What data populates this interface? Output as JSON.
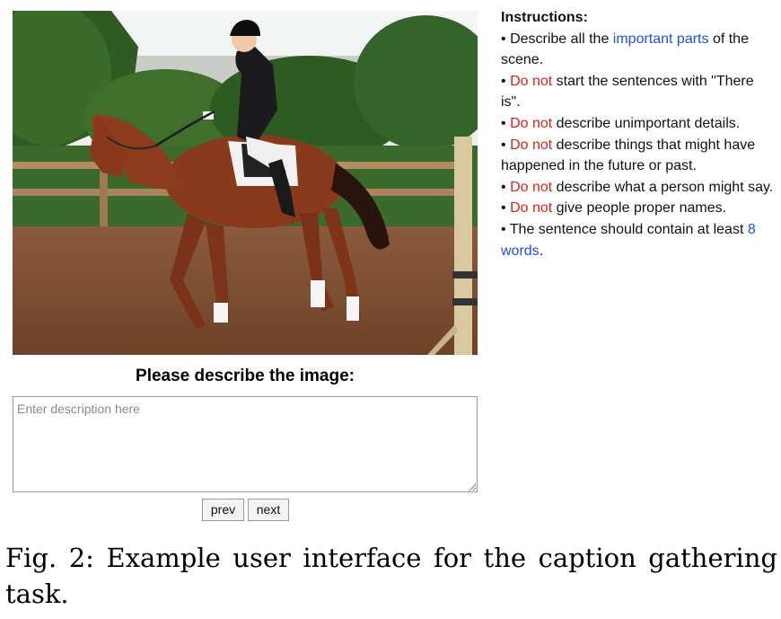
{
  "photo_icon": "horse-rider-photo",
  "instructions": {
    "title": "Instructions:",
    "items": [
      {
        "pre": "Describe all the ",
        "hl": "important parts",
        "post": " of the scene."
      },
      {
        "pre": "",
        "hl": "Do not",
        "post": " start the sentences with \"There is\"."
      },
      {
        "pre": "",
        "hl": "Do not",
        "post": " describe unimportant details."
      },
      {
        "pre": "",
        "hl": "Do not",
        "post": " describe things that might have happened in the future or past."
      },
      {
        "pre": "",
        "hl": "Do not",
        "post": " describe what a person might say."
      },
      {
        "pre": "",
        "hl": "Do not",
        "post": " give people proper names."
      },
      {
        "pre": "The sentence should contain at least ",
        "hl": "8 words",
        "post": "."
      }
    ],
    "bullet": "•"
  },
  "form": {
    "prompt": "Please describe the image:",
    "placeholder": "Enter description here",
    "prev_label": "prev",
    "next_label": "next"
  },
  "caption": "Fig. 2: Example user interface for the caption gathering task.",
  "colors": {
    "highlight_blue": "#1f4fdc",
    "highlight_red": "#e0221b"
  }
}
